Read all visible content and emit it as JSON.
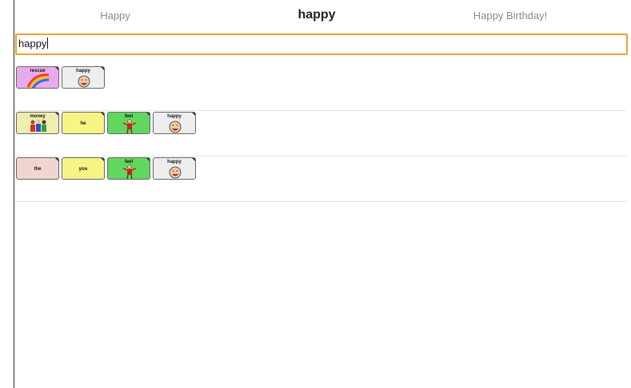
{
  "suggestions": [
    "Happy",
    "happy",
    "Happy Birthday!"
  ],
  "search": {
    "value": "happy"
  },
  "rows": [
    {
      "tiles": [
        {
          "label": "rescue",
          "color": "#e8aaee",
          "pictogram": "rainbow-pictogram"
        },
        {
          "label": "happy",
          "color": "#eeeeee",
          "pictogram": "happy-face-pictogram"
        }
      ]
    },
    {
      "tiles": [
        {
          "label": "money",
          "color": "#eeeeb0",
          "pictogram": "people-group-pictogram"
        },
        {
          "label": "he",
          "color": "#f5f585",
          "pictogram": ""
        },
        {
          "label": "feel",
          "color": "#60d860",
          "pictogram": "feel-figure-pictogram"
        },
        {
          "label": "happy",
          "color": "#eeeeee",
          "pictogram": "happy-face-pictogram"
        }
      ]
    },
    {
      "tiles": [
        {
          "label": "the",
          "color": "#f2d4d0",
          "pictogram": ""
        },
        {
          "label": "you",
          "color": "#f5f585",
          "pictogram": ""
        },
        {
          "label": "feel",
          "color": "#60d860",
          "pictogram": "feel-figure-pictogram"
        },
        {
          "label": "happy",
          "color": "#eeeeee",
          "pictogram": "happy-face-pictogram"
        }
      ]
    }
  ]
}
